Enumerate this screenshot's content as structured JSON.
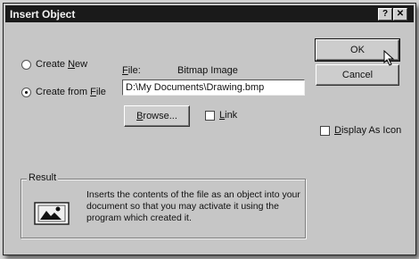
{
  "dialog": {
    "title": "Insert Object",
    "help_label": "?",
    "close_label": "✕"
  },
  "options": {
    "create_new": {
      "pre": "Create ",
      "key": "N",
      "post": "ew",
      "selected": false
    },
    "create_from_file": {
      "pre": "Create from ",
      "key": "F",
      "post": "ile",
      "selected": true
    }
  },
  "file": {
    "label_key": "F",
    "label_rest": "ile:",
    "type_text": "Bitmap Image",
    "path_value": "D:\\My Documents\\Drawing.bmp"
  },
  "buttons": {
    "ok": "OK",
    "cancel": "Cancel",
    "browse_key": "B",
    "browse_rest": "rowse..."
  },
  "link": {
    "key": "L",
    "rest": "ink",
    "checked": false
  },
  "display_as_icon": {
    "pre": "",
    "key": "D",
    "rest": "isplay As Icon",
    "checked": false
  },
  "result": {
    "title": "Result",
    "text": "Inserts the contents of the file as an object into your document so that you may activate it using the program which created it.",
    "icon": "object-picture-icon"
  }
}
